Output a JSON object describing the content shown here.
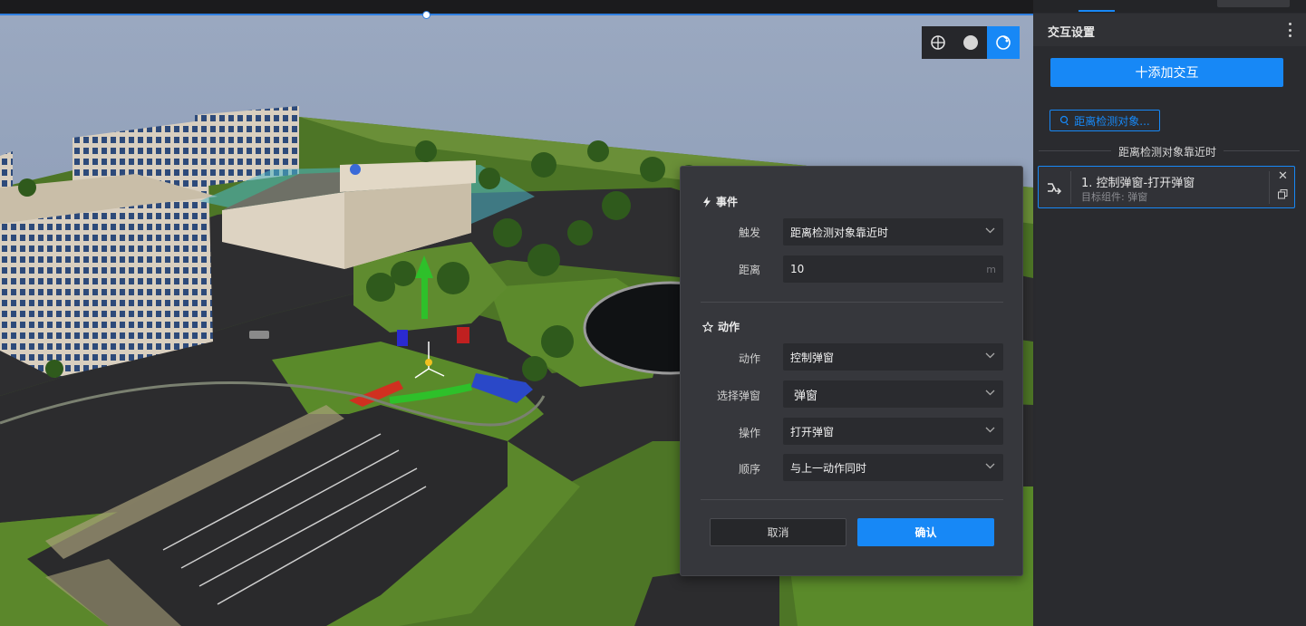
{
  "panel": {
    "title": "交互设置",
    "add_button_label": "十添加交互",
    "event_tag": "距离检测对象...",
    "event_group_label": "距离检测对象靠近时",
    "action_card": {
      "name": "1. 控制弹窗-打开弹窗",
      "target": "目标组件: 弹窗"
    }
  },
  "view_tools": {
    "icons": [
      "globe-icon",
      "sphere-icon",
      "rotate-icon"
    ],
    "active": "rotate-icon"
  },
  "dialog": {
    "event_section": "事件",
    "trigger_label": "触发",
    "trigger_value": "距离检测对象靠近时",
    "distance_label": "距离",
    "distance_value": "10",
    "distance_unit": "m",
    "action_section": "动作",
    "action_label": "动作",
    "action_value": "控制弹窗",
    "select_popup_label": "选择弹窗",
    "select_popup_value": "弹窗",
    "operation_label": "操作",
    "operation_value": "打开弹窗",
    "order_label": "顺序",
    "order_value": "与上一动作同时",
    "cancel_label": "取消",
    "confirm_label": "确认"
  },
  "colors": {
    "accent": "#1788f6",
    "panel_bg": "#2a2b2f",
    "dialog_bg": "#36373c",
    "grass": "#5f8a2e",
    "road": "#2c2c2e",
    "sky": "#8a9ab4"
  }
}
